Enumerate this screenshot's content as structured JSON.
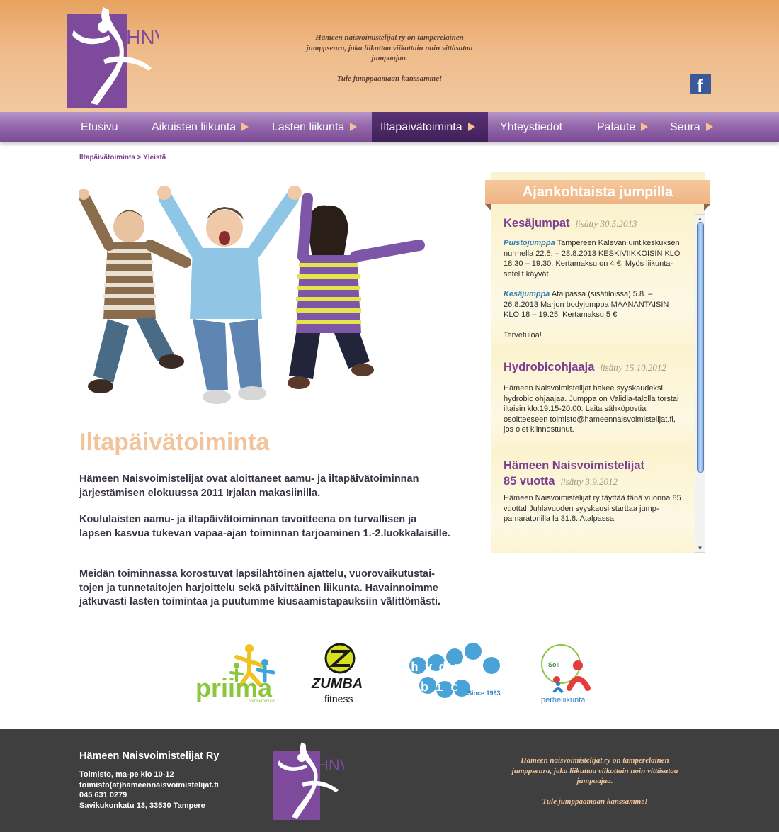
{
  "header": {
    "logo_text": "HNV",
    "tagline": "Hämeen naisvoimistelijat ry on tamperelainen jumppseura, joka liikuttaa viikottain noin vittäsataa jumpaajaa.",
    "tagline_cta": "Tule jumppaamaan kanssamme!",
    "facebook_glyph": "f"
  },
  "nav": {
    "items": [
      {
        "label": "Etusivu",
        "has_arrow": false
      },
      {
        "label": "Aikuisten liikunta",
        "has_arrow": true
      },
      {
        "label": "Lasten liikunta",
        "has_arrow": true
      },
      {
        "label": "Iltapäivätoiminta",
        "has_arrow": true,
        "active": true
      },
      {
        "label": "Yhteystiedot",
        "has_arrow": false
      },
      {
        "label": "Palaute",
        "has_arrow": true
      },
      {
        "label": "Seura",
        "has_arrow": true
      }
    ]
  },
  "breadcrumb": "Iltapäivätoiminta > Yleistä",
  "main": {
    "title": "Iltapäivätoiminta",
    "paragraphs": [
      "Hämeen Naisvoimistelijat ovat aloittaneet aamu- ja iltapäivätoiminnan järjestämisen elokuussa 2011 Irjalan makasiinilla.",
      "Koululaisten aamu- ja iltapäivätoiminnan tavoitteena on turvallisen ja lapsen kasvua tukevan vapaa-ajan toiminnan tarjoaminen 1.-2.luokkalaisille.",
      "Meidän toiminnassa korostuvat lapsilähtöinen ajattelu, vuorovaikutustai-tojen ja tunnetaitojen harjoittelu sekä päivittäinen liikunta. Havainnoimme jatkuvasti lasten toimintaa ja puutumme kiusaamistapauksiin välittömästi."
    ]
  },
  "news": {
    "heading": "Ajankohtaista jumpilla",
    "items": [
      {
        "title": "Kesäjumpat",
        "added": "lisätty 30.5.2013",
        "p1_hl": "Puistojumppa",
        "p1": " Tampereen Kalevan uintikeskuksen nurmella 22.5. – 28.8.2013 KESKIVIIKKOISIN KLO 18.30 – 19.30. Kertamaksu on 4 €. Myös liikunta-setelit käyvät.",
        "p2_hl": "Kesäjumppa",
        "p2": " Atalpassa (sisätiloissa) 5.8. – 26.8.2013 Marjon bodyjumppa MAANANTAISIN KLO 18 – 19.25. Kertamaksu 5 €",
        "p3": "Tervetuloa!"
      },
      {
        "title": "Hydrobicohjaaja",
        "added": "lisätty 15.10.2012",
        "p1": "Hämeen Naisvoimistelijat hakee syyskaudeksi hydrobic ohjaajaa. Jumppa on Validia-talolla torstai iltaisin klo:19.15-20.00. Laita sähköpostia osoitteeseen toimisto@hameennaisvoimistelijat.fi, jos olet kiinnostunut."
      },
      {
        "title_line1": "Hämeen Naisvoimistelijat",
        "title_line2": "85 vuotta",
        "added": "lisätty 3.9.2012",
        "p1": "Hämeen Naisvoimistelijat ry täyttää tänä vuonna 85 vuotta! Juhlavuoden syyskausi starttaa jump-pamaratonilla la 31.8. Atalpassa."
      }
    ]
  },
  "partners": {
    "priima": {
      "name": "priima",
      "sub": "Vanhemmuus"
    },
    "zumba": {
      "name": "ZUMBA",
      "sub": "fitness"
    },
    "hydrobic": {
      "row1": "hydro",
      "row2": "bic",
      "since": "Since 1993"
    },
    "perhe": {
      "soil": "Soli",
      "name": "perheliikunta"
    }
  },
  "footer": {
    "name": "Hämeen Naisvoimistelijat Ry",
    "office": "Toimisto, ma-pe klo 10-12",
    "email": "toimisto(at)hameennaisvoimistelijat.fi",
    "phone": "045 631 0279",
    "address": "Savikukonkatu 13, 33530 Tampere",
    "tagline": "Hämeen naisvoimistelijat ry on tamperelainen jumppseura, joka liikuttaa viikottain noin vittäsataa jumpaajaa.",
    "tagline_cta": "Tule jumppaamaan kanssamme!"
  },
  "colors": {
    "brand_purple": "#7b3f92",
    "accent_peach": "#f2c49b",
    "link_blue": "#2d7db8"
  }
}
